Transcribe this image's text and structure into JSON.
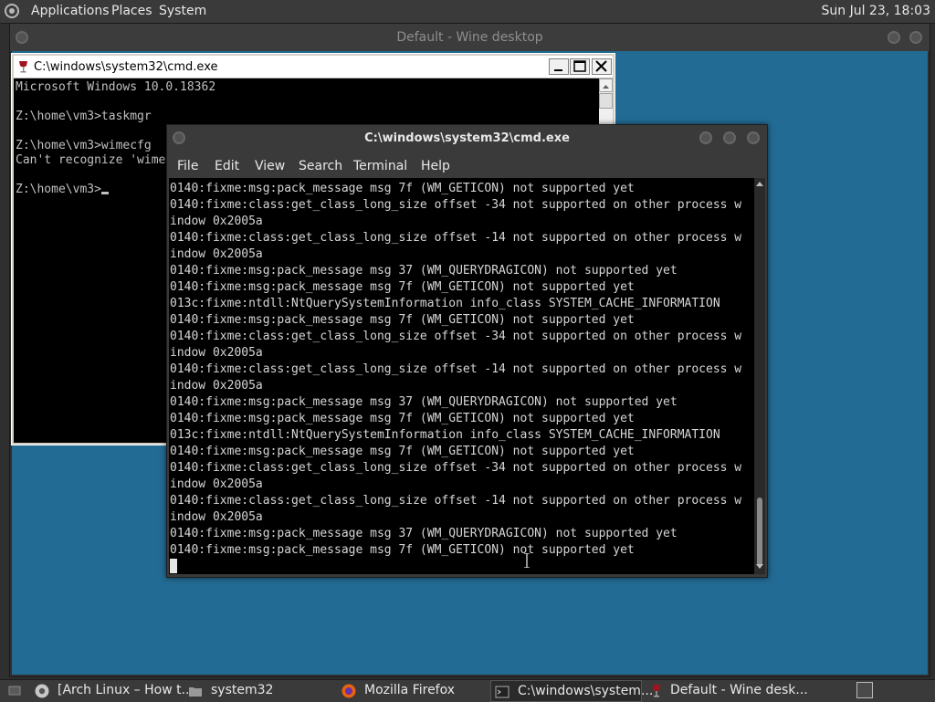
{
  "top_panel": {
    "menus": [
      "Applications",
      "Places",
      "System"
    ],
    "clock": "Sun Jul 23, 18:03"
  },
  "wine_desktop": {
    "title": "Default - Wine desktop"
  },
  "cmd_back": {
    "title": "C:\\windows\\system32\\cmd.exe",
    "lines": [
      "Microsoft Windows 10.0.18362",
      "",
      "Z:\\home\\vm3>taskmgr",
      "",
      "Z:\\home\\vm3>wimecfg",
      "Can't recognize 'wime",
      "",
      "Z:\\home\\vm3>"
    ]
  },
  "terminal": {
    "title": "C:\\windows\\system32\\cmd.exe",
    "menu": [
      "File",
      "Edit",
      "View",
      "Search",
      "Terminal",
      "Help"
    ],
    "lines": [
      "0140:fixme:msg:pack_message msg 7f (WM_GETICON) not supported yet",
      "0140:fixme:class:get_class_long_size offset -34 not supported on other process w",
      "indow 0x2005a",
      "0140:fixme:class:get_class_long_size offset -14 not supported on other process w",
      "indow 0x2005a",
      "0140:fixme:msg:pack_message msg 37 (WM_QUERYDRAGICON) not supported yet",
      "0140:fixme:msg:pack_message msg 7f (WM_GETICON) not supported yet",
      "013c:fixme:ntdll:NtQuerySystemInformation info_class SYSTEM_CACHE_INFORMATION",
      "0140:fixme:msg:pack_message msg 7f (WM_GETICON) not supported yet",
      "0140:fixme:class:get_class_long_size offset -34 not supported on other process w",
      "indow 0x2005a",
      "0140:fixme:class:get_class_long_size offset -14 not supported on other process w",
      "indow 0x2005a",
      "0140:fixme:msg:pack_message msg 37 (WM_QUERYDRAGICON) not supported yet",
      "0140:fixme:msg:pack_message msg 7f (WM_GETICON) not supported yet",
      "013c:fixme:ntdll:NtQuerySystemInformation info_class SYSTEM_CACHE_INFORMATION",
      "0140:fixme:msg:pack_message msg 7f (WM_GETICON) not supported yet",
      "0140:fixme:class:get_class_long_size offset -34 not supported on other process w",
      "indow 0x2005a",
      "0140:fixme:class:get_class_long_size offset -14 not supported on other process w",
      "indow 0x2005a",
      "0140:fixme:msg:pack_message msg 37 (WM_QUERYDRAGICON) not supported yet",
      "0140:fixme:msg:pack_message msg 7f (WM_GETICON) not supported yet"
    ]
  },
  "taskbar": {
    "items": [
      {
        "label": "[Arch Linux – How t...",
        "icon": "chrome-icon"
      },
      {
        "label": "system32",
        "icon": "folder-icon"
      },
      {
        "label": "Mozilla Firefox",
        "icon": "firefox-icon"
      },
      {
        "label": "C:\\windows\\system...",
        "icon": "terminal-icon"
      },
      {
        "label": "Default - Wine desk...",
        "icon": "wine-icon"
      }
    ]
  },
  "colors": {
    "desktop": "#226b94",
    "panel": "#3a3a3a",
    "terminal_bg": "#000000",
    "terminal_fg": "#d6d6d6"
  }
}
